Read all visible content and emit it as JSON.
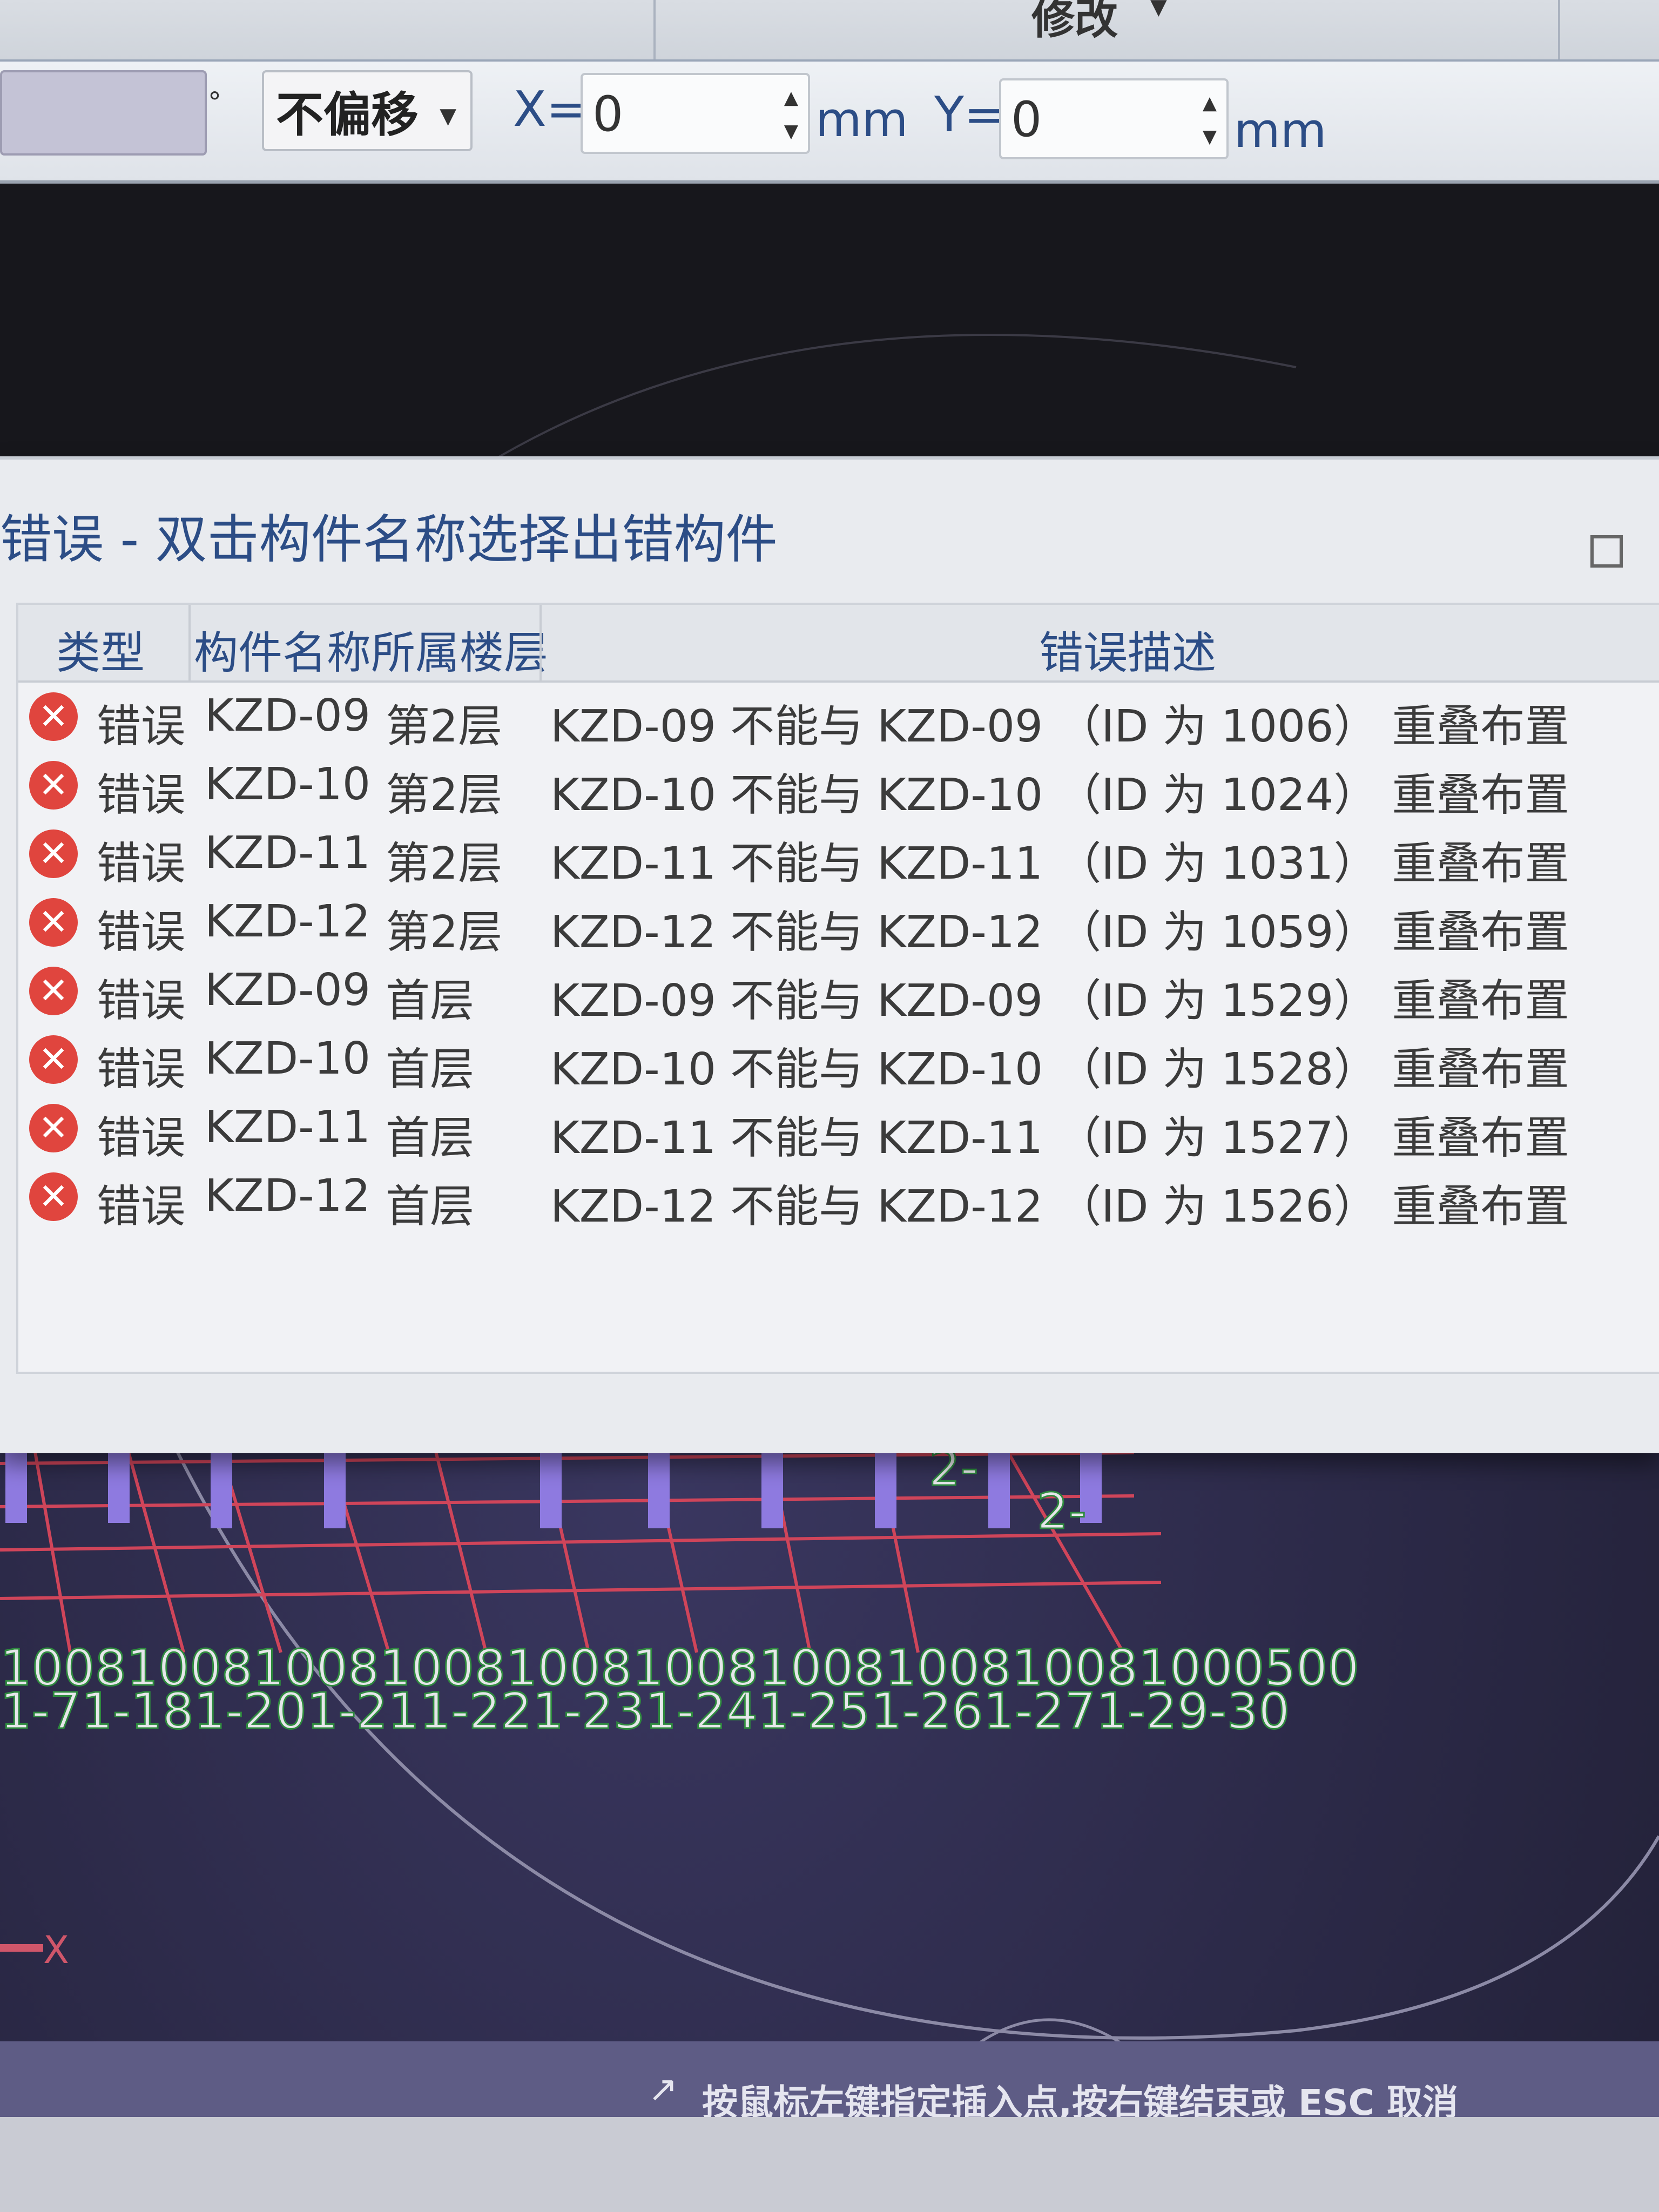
{
  "ribbon": {
    "group_left": "",
    "group_right": "修改"
  },
  "toolbar": {
    "offset_mode": "不偏移",
    "x_label": "X=",
    "x_value": "0",
    "x_unit": "mm",
    "y_label": "Y=",
    "y_value": "0",
    "y_unit": "mm",
    "degree_symbol": "°"
  },
  "dialog": {
    "title": "错误 - 双击构件名称选择出错构件",
    "columns": {
      "type": "类型",
      "name_floor": "构件名称所属楼层",
      "description": "错误描述"
    },
    "rows": [
      {
        "type": "错误",
        "name": "KZD-09",
        "floor": "第2层",
        "desc": "KZD-09 不能与 KZD-09 （ID 为 1006） 重叠布置"
      },
      {
        "type": "错误",
        "name": "KZD-10",
        "floor": "第2层",
        "desc": "KZD-10 不能与 KZD-10 （ID 为 1024） 重叠布置"
      },
      {
        "type": "错误",
        "name": "KZD-11",
        "floor": "第2层",
        "desc": "KZD-11 不能与 KZD-11 （ID 为 1031） 重叠布置"
      },
      {
        "type": "错误",
        "name": "KZD-12",
        "floor": "第2层",
        "desc": "KZD-12 不能与 KZD-12 （ID 为 1059） 重叠布置"
      },
      {
        "type": "错误",
        "name": "KZD-09",
        "floor": "首层",
        "desc": "KZD-09 不能与 KZD-09 （ID 为 1529） 重叠布置"
      },
      {
        "type": "错误",
        "name": "KZD-10",
        "floor": "首层",
        "desc": "KZD-10 不能与 KZD-10 （ID 为 1528） 重叠布置"
      },
      {
        "type": "错误",
        "name": "KZD-11",
        "floor": "首层",
        "desc": "KZD-11 不能与 KZD-11 （ID 为 1527） 重叠布置"
      },
      {
        "type": "错误",
        "name": "KZD-12",
        "floor": "首层",
        "desc": "KZD-12 不能与 KZD-12 （ID 为 1526） 重叠布置"
      }
    ]
  },
  "viewport": {
    "dimension_text": "1008100810081008100810081008100810081000500",
    "axis_labels_text": "1-71-181-201-211-221-231-241-251-261-271-29-30",
    "axis_x": "X",
    "right_label": "2-",
    "right_label_2": "2-",
    "colors": {
      "grid": "#d0455a",
      "column": "#8e7ae0",
      "label": "#e6e6ea",
      "label_outline": "#2e8a3e"
    }
  },
  "status": {
    "text": "按鼠标左键指定插入点,按右键结束或 ESC 取消"
  }
}
